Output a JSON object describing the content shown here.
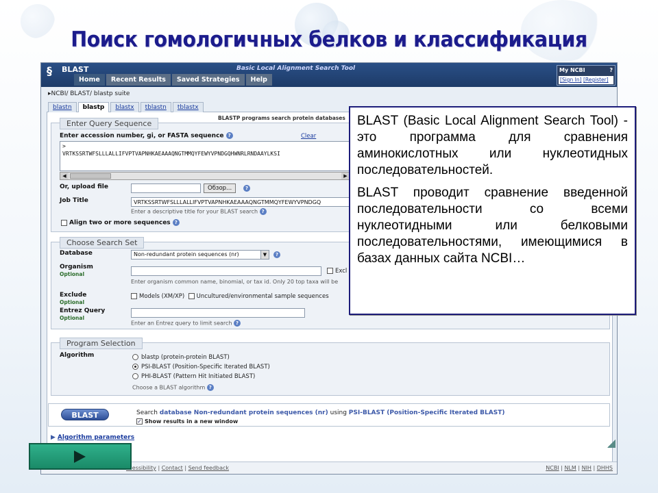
{
  "slide": {
    "title": "Поиск гомологичных белков и классификация",
    "callout": {
      "p1": "BLAST (Basic Local Alignment Search Tool) - это программа для сравнения аминокислотных или нуклеотидных последовательностей.",
      "p2": "BLAST проводит сравнение введенной последовательности со всеми нуклеотидными или белковыми последовательностями, имеющимися в базах данных сайта NCBI…"
    }
  },
  "header": {
    "logo": "BLAST",
    "subtitle": "Basic Local Alignment Search Tool",
    "nav": [
      "Home",
      "Recent Results",
      "Saved Strategies",
      "Help"
    ],
    "myncbi": {
      "title": "My NCBI",
      "help": "?",
      "sign_in": "[Sign In]",
      "register": "[Register]"
    }
  },
  "breadcrumb": "▸NCBI/ BLAST/ blastp suite",
  "tabs": [
    "blastn",
    "blastp",
    "blastx",
    "tblastn",
    "tblastx"
  ],
  "active_tab": "blastp",
  "tab_description": "BLASTP programs search protein databases",
  "query": {
    "legend": "Enter Query Sequence",
    "label": "Enter accession number, gi, or FASTA sequence",
    "clear": "Clear",
    "seq_line1": ">",
    "seq_line2": "VRTKSSRTWFSLLLALLIFVPTVAPNHKAEAAAQNGTMMQYFEWYVPNDGQHWNRLRNDAAYLKSI",
    "upload_label": "Or, upload file",
    "browse": "Обзор...",
    "job_title_label": "Job Title",
    "job_title_value": "VRTKSSRTWFSLLLALLIFVPTVAPNHKAEAAAQNGTMMQYFEWYVPNDGQ",
    "job_title_hint": "Enter a descriptive title for your BLAST search",
    "align_two": "Align two or more sequences"
  },
  "search_set": {
    "legend": "Choose Search Set",
    "database_label": "Database",
    "database_value": "Non-redundant protein sequences (nr)",
    "organism_label": "Organism",
    "optional": "Optional",
    "organism_exclude": "Excl",
    "organism_hint": "Enter organism common name, binomial, or tax id. Only 20 top taxa will be",
    "exclude_label": "Exclude",
    "exclude_opt1": "Models (XM/XP)",
    "exclude_opt2": "Uncultured/environmental sample sequences",
    "entrez_label": "Entrez Query",
    "entrez_hint": "Enter an Entrez query to limit search"
  },
  "program": {
    "legend": "Program Selection",
    "algorithm_label": "Algorithm",
    "options": [
      "blastp (protein-protein BLAST)",
      "PSI-BLAST (Position-Specific Iterated BLAST)",
      "PHI-BLAST (Pattern Hit Initiated BLAST)"
    ],
    "selected": 1,
    "hint": "Choose a BLAST algorithm"
  },
  "submit": {
    "button": "BLAST",
    "search_prefix": "Search",
    "search_db": "database Non-redundant protein sequences (nr)",
    "search_using": "using",
    "search_algo": "PSI-BLAST (Position-Specific Iterated BLAST)",
    "new_window": "Show results in a new window"
  },
  "algorithm_parameters": "Algorithm parameters",
  "footer": {
    "left": [
      "ccessibility",
      "Contact",
      "Send feedback"
    ],
    "right": [
      "NCBI",
      "NLM",
      "NIH",
      "DHHS"
    ]
  },
  "colors": {
    "title": "#1c1c8c",
    "header_bg": "#1d3b68",
    "play_button": "#1a8a68"
  }
}
